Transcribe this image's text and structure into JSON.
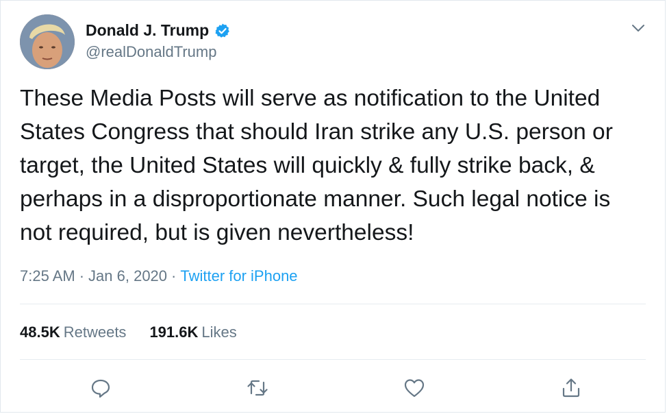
{
  "user": {
    "name": "Donald J. Trump",
    "handle": "@realDonaldTrump",
    "verified": true
  },
  "tweet": {
    "text": "These Media Posts will serve as notification to the United\nStates Congress that should Iran strike any U.S. person or\ntarget, the United States will quickly & fully strike back, &\nperhaps in a disproportionate manner. Such legal notice is\nnot required, but is given nevertheless!",
    "time": "7:25 AM",
    "sep1": "·",
    "date": "Jan 6, 2020",
    "sep2": "·",
    "source": "Twitter for iPhone"
  },
  "stats": {
    "retweets_count": "48.5K",
    "retweets_label": "Retweets",
    "likes_count": "191.6K",
    "likes_label": "Likes"
  },
  "icons": {
    "verified": "verified-badge-icon",
    "menu": "chevron-down-icon",
    "reply": "reply-icon",
    "retweet": "retweet-icon",
    "like": "heart-icon",
    "share": "share-icon"
  },
  "colors": {
    "text": "#14171a",
    "secondary": "#657786",
    "accent": "#1da1f2"
  }
}
